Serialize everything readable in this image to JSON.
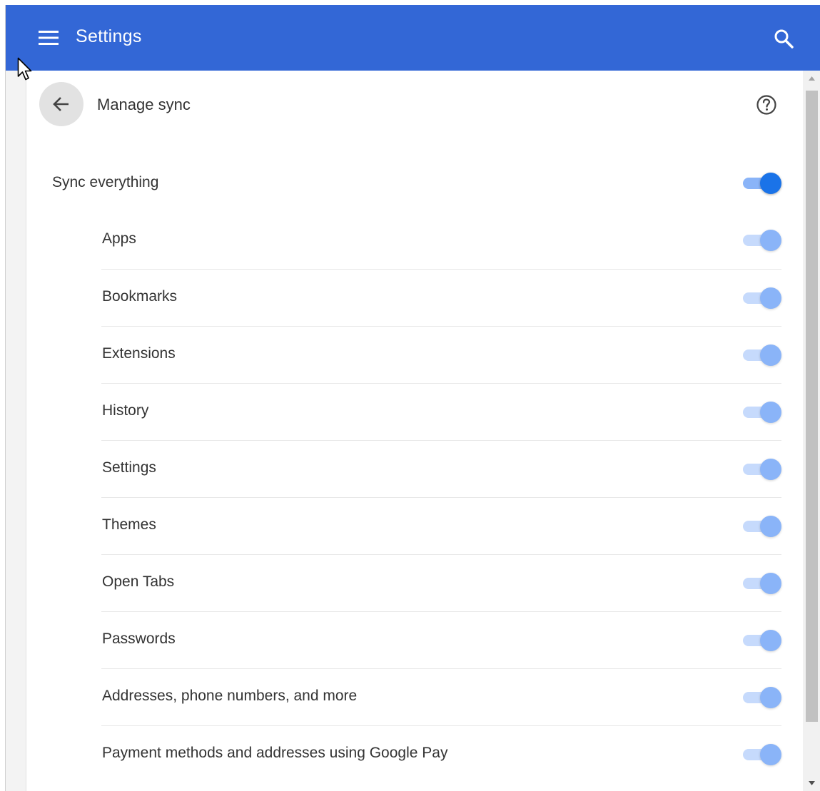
{
  "topbar": {
    "title": "Settings",
    "menu_icon": "hamburger-menu-icon",
    "search_icon": "search-icon",
    "background": "#3367d6"
  },
  "page": {
    "title": "Manage sync",
    "back_icon": "back-arrow-icon",
    "help_icon": "help-circle-icon"
  },
  "sync_everything": {
    "label": "Sync everything",
    "enabled": true
  },
  "sync_items": [
    {
      "label": "Apps",
      "enabled": true,
      "disabled": true
    },
    {
      "label": "Bookmarks",
      "enabled": true,
      "disabled": true
    },
    {
      "label": "Extensions",
      "enabled": true,
      "disabled": true
    },
    {
      "label": "History",
      "enabled": true,
      "disabled": true
    },
    {
      "label": "Settings",
      "enabled": true,
      "disabled": true
    },
    {
      "label": "Themes",
      "enabled": true,
      "disabled": true
    },
    {
      "label": "Open Tabs",
      "enabled": true,
      "disabled": true
    },
    {
      "label": "Passwords",
      "enabled": true,
      "disabled": true
    },
    {
      "label": "Addresses, phone numbers, and more",
      "enabled": true,
      "disabled": true
    },
    {
      "label": "Payment methods and addresses using Google Pay",
      "enabled": true,
      "disabled": true
    }
  ],
  "colors": {
    "accent": "#1a73e8",
    "toggle_track_on": "#8ab4f8",
    "toggle_track_disabled": "#c6dafc"
  }
}
